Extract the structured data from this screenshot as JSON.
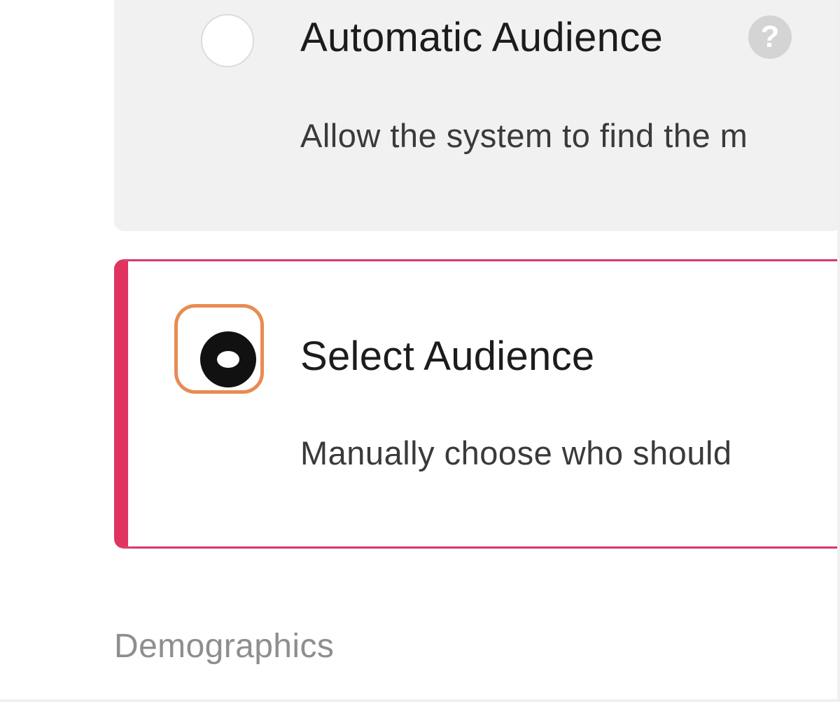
{
  "audience_options": [
    {
      "title": "Automatic Audience",
      "description": "Allow the system to find the m",
      "selected": false,
      "help_icon": "question-mark-icon"
    },
    {
      "title": "Select Audience",
      "description": "Manually choose who should",
      "selected": true
    }
  ],
  "help_glyph": "?",
  "section": {
    "heading": "Demographics"
  },
  "colors": {
    "selected_accent": "#e0335f",
    "focus_ring": "#e88b52",
    "unselected_card_bg": "#f1f1f1",
    "heading_gray": "#8e8e8e"
  }
}
